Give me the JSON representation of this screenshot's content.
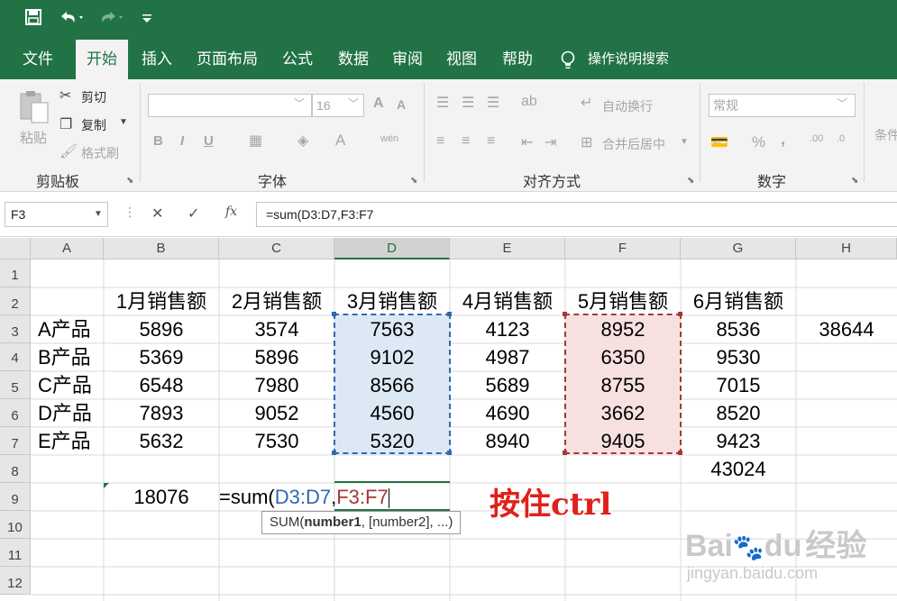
{
  "qat": {
    "save_icon": "save-icon",
    "undo_icon": "undo-icon",
    "redo_icon": "redo-icon",
    "customize_icon": "customize-icon"
  },
  "menu": {
    "items": [
      "文件",
      "开始",
      "插入",
      "页面布局",
      "公式",
      "数据",
      "审阅",
      "视图",
      "帮助"
    ],
    "active": "开始",
    "search": "操作说明搜索"
  },
  "ribbon": {
    "clipboard": {
      "paste": "粘贴",
      "cut": "剪切",
      "copy": "复制",
      "format_painter": "格式刷",
      "label": "剪贴板"
    },
    "font": {
      "font_name": "",
      "font_size": "16",
      "bold": "B",
      "italic": "I",
      "underline": "U",
      "label": "字体",
      "grow": "A",
      "shrink": "A",
      "color": "A",
      "phonetic": "wén"
    },
    "alignment": {
      "wrap": "自动换行",
      "merge": "合并后居中",
      "label": "对齐方式"
    },
    "number": {
      "format": "常规",
      "percent": "%",
      "comma": ",",
      "label": "数字"
    },
    "styles": {
      "cond": "条件"
    }
  },
  "formula_bar": {
    "name_box": "F3",
    "formula": "=sum(D3:D7,F3:F7",
    "cancel": "✕",
    "enter": "✓",
    "fx": "fx"
  },
  "columns": [
    "A",
    "B",
    "C",
    "D",
    "E",
    "F",
    "G",
    "H"
  ],
  "rows": [
    "1",
    "2",
    "3",
    "4",
    "5",
    "6",
    "7",
    "8",
    "9",
    "10",
    "11",
    "12"
  ],
  "headers": [
    "1月销售额",
    "2月销售额",
    "3月销售额",
    "4月销售额",
    "5月销售额",
    "6月销售额"
  ],
  "products": [
    "A产品",
    "B产品",
    "C产品",
    "D产品",
    "E产品"
  ],
  "table": [
    [
      "5896",
      "3574",
      "7563",
      "4123",
      "8952",
      "8536"
    ],
    [
      "5369",
      "5896",
      "9102",
      "4987",
      "6350",
      "9530"
    ],
    [
      "6548",
      "7980",
      "8566",
      "5689",
      "8755",
      "7015"
    ],
    [
      "7893",
      "9052",
      "4560",
      "4690",
      "3662",
      "8520"
    ],
    [
      "5632",
      "7530",
      "5320",
      "8940",
      "9405",
      "9423"
    ]
  ],
  "extra": {
    "h3": "38644",
    "g8": "43024",
    "b9": "18076"
  },
  "editing": {
    "prefix": "=sum(",
    "ref1": "D3:D7",
    "sep": ",",
    "ref2": "F3:F7"
  },
  "tooltip": {
    "fn": "SUM(",
    "arg1": "number1",
    "rest": ", [number2], ...)"
  },
  "annotation": "按住ctrl",
  "watermark": {
    "brand": "Bai",
    "brand2": "经验",
    "url": "jingyan.baidu.com"
  },
  "colors": {
    "excel_green": "#217346",
    "ref_blue": "#2e69b3",
    "ref_red": "#a23a35",
    "annotation_red": "#e0201c"
  }
}
